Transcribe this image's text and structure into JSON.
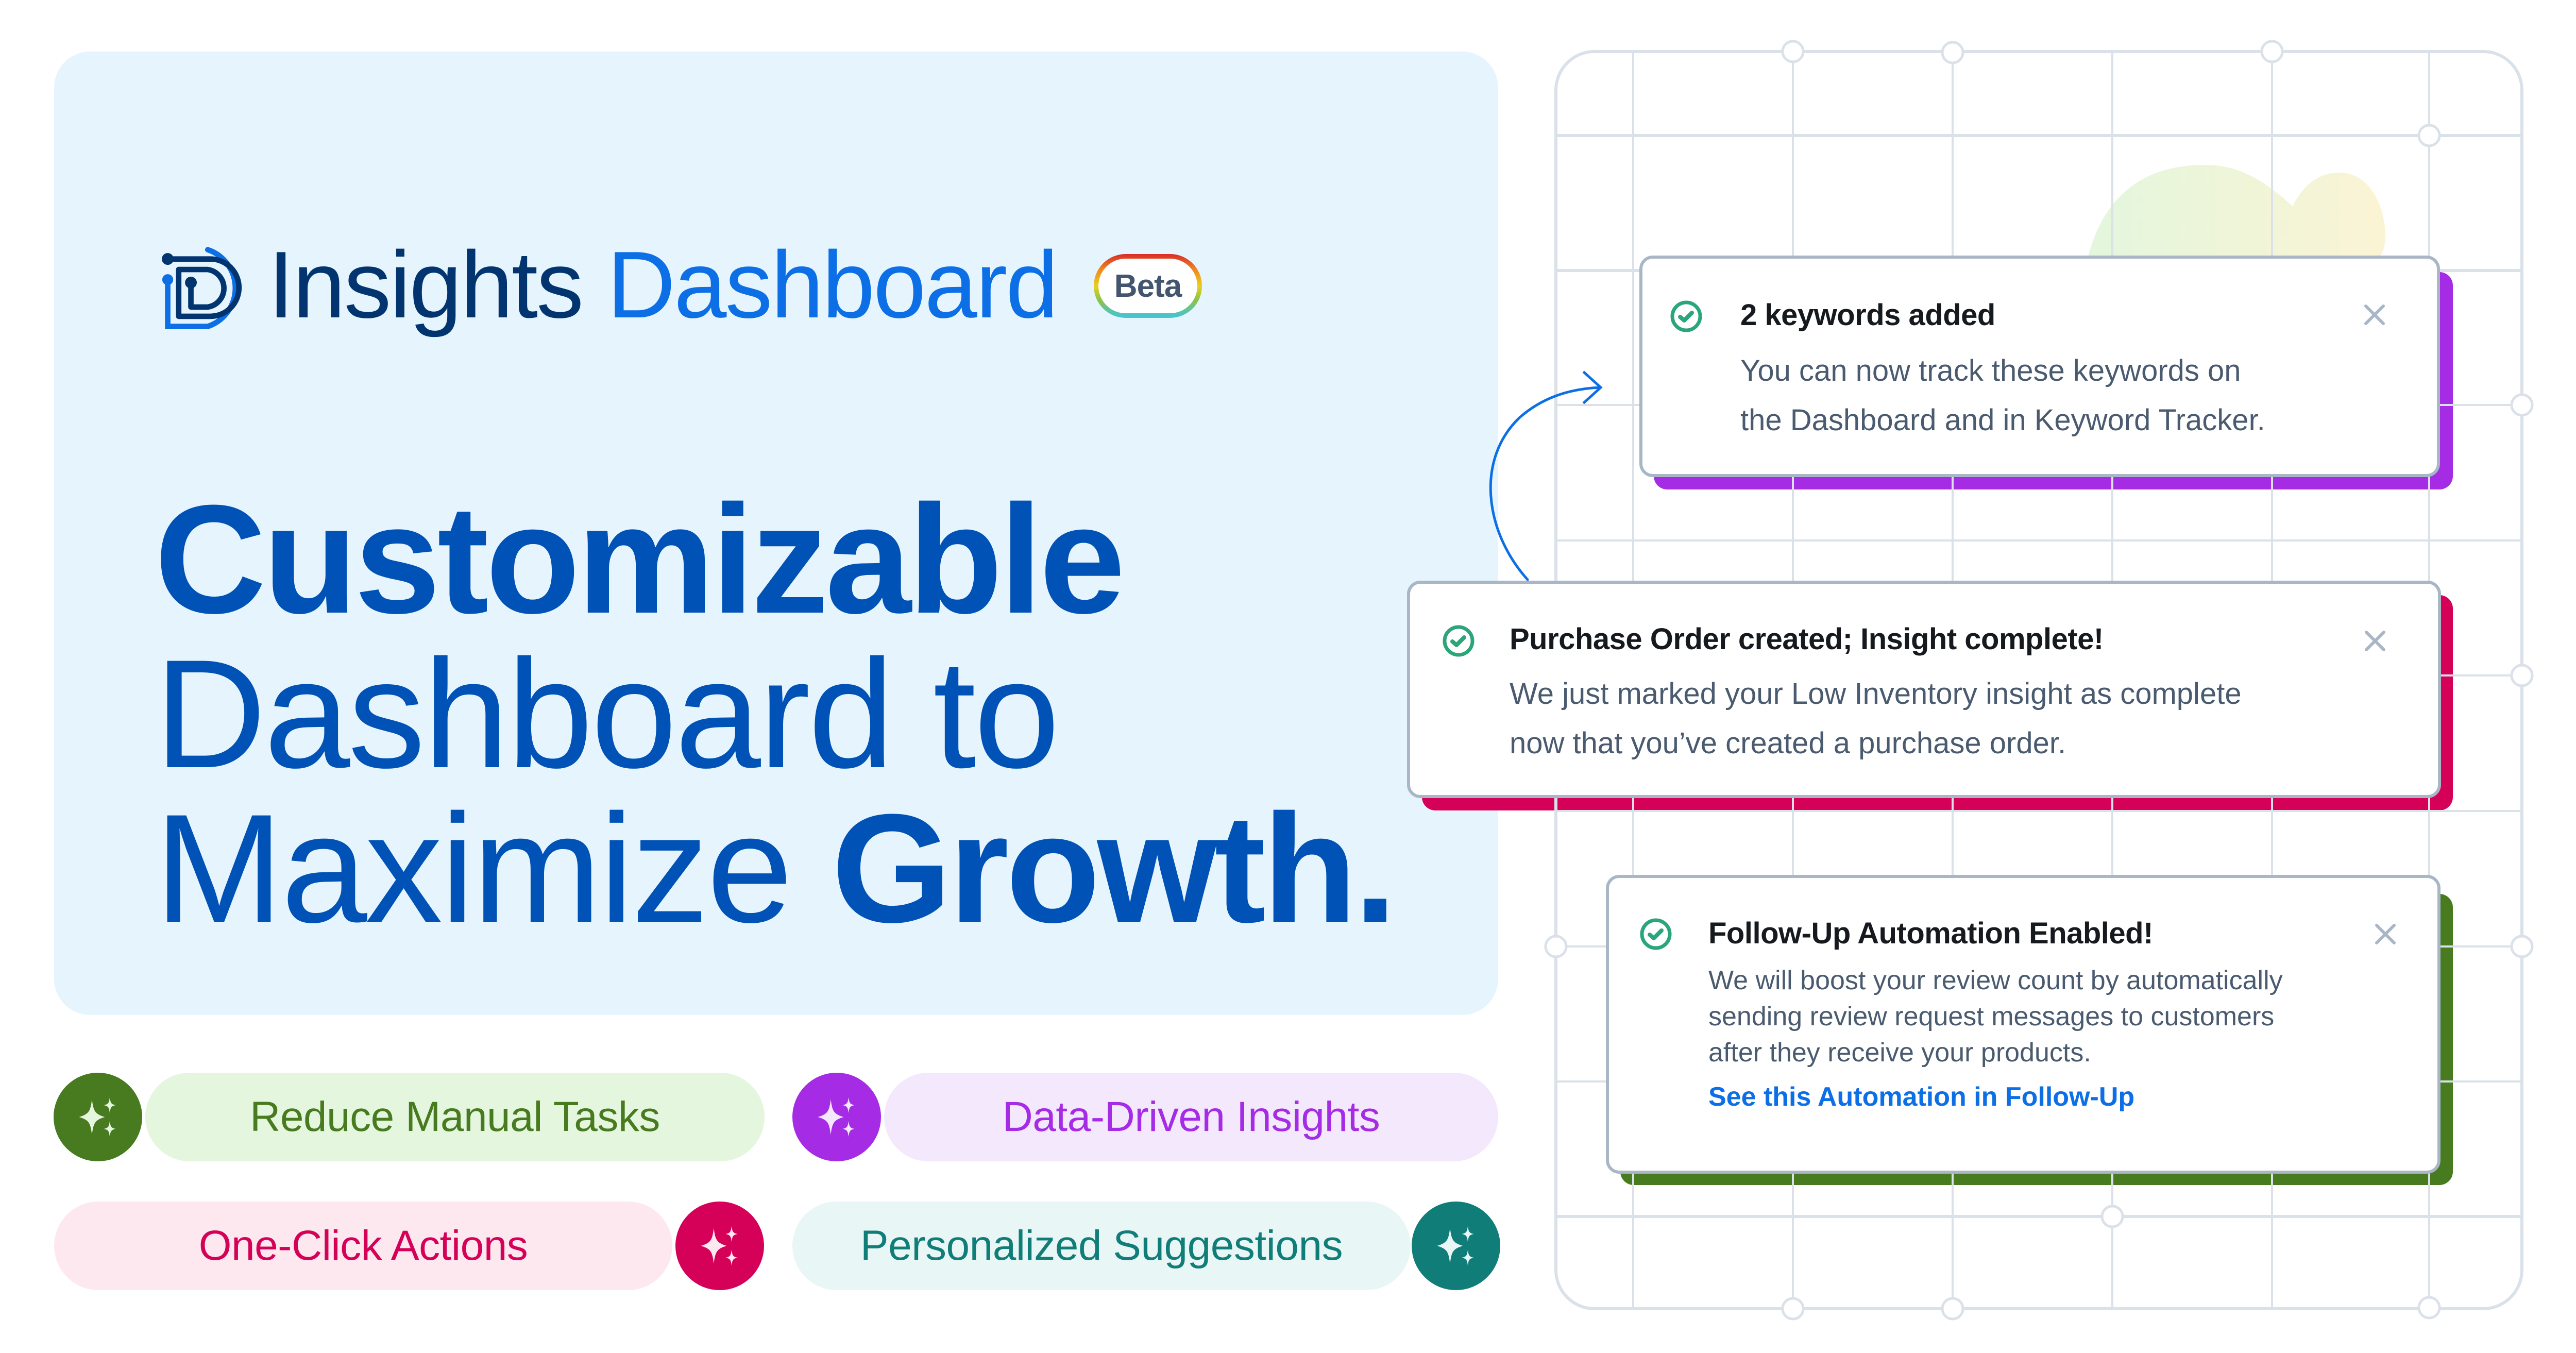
{
  "brand": {
    "logo_icon": "insights-d-logo-icon",
    "title_word_1": "Insights",
    "title_word_2": "Dashboard",
    "badge": "Beta"
  },
  "headline": {
    "line1_bold": "Customizable",
    "line2_light": "Dashboard to",
    "line3_light": "Maximize ",
    "line3_bold": "Growth."
  },
  "features": [
    {
      "label": "Reduce Manual Tasks",
      "icon": "sparkles-icon",
      "color": "#487A20",
      "bg": "#E4F6DE"
    },
    {
      "label": "Data-Driven Insights",
      "icon": "sparkles-icon",
      "color": "#A52BE5",
      "bg": "#F3E8FC"
    },
    {
      "label": "One-Click Actions",
      "icon": "sparkles-icon",
      "color": "#D50057",
      "bg": "#FDE8EF"
    },
    {
      "label": "Personalized Suggestions",
      "icon": "sparkles-icon",
      "color": "#117D78",
      "bg": "#E8F6F5"
    }
  ],
  "notifications": [
    {
      "title": "2 keywords added",
      "body": "You can now track these keywords on\nthe Dashboard and in Keyword Tracker.",
      "status_icon": "check-circle-icon",
      "close_icon": "close-icon",
      "accent": "#A52BE5"
    },
    {
      "title": "Purchase Order created; Insight complete!",
      "body": "We just marked your Low Inventory insight as complete\nnow that you’ve created a purchase order.",
      "status_icon": "check-circle-icon",
      "close_icon": "close-icon",
      "accent": "#D50057"
    },
    {
      "title": "Follow-Up Automation Enabled!",
      "body": "We will boost your review count by automatically\nsending review request messages to customers\nafter they receive your products.",
      "link": "See this Automation in Follow-Up",
      "status_icon": "check-circle-icon",
      "close_icon": "close-icon",
      "accent": "#487A20"
    }
  ],
  "colors": {
    "brand_dark": "#02356F",
    "brand_blue": "#0C6FE6",
    "headline": "#0052B6",
    "panel_bg": "#E6F5FD",
    "success": "#2BA57A",
    "grid_line": "#DAE1E9"
  }
}
